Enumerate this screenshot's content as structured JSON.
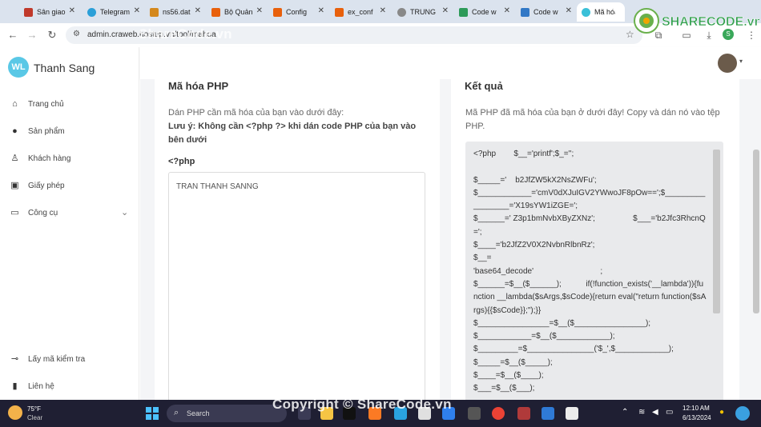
{
  "browser": {
    "tabs": [
      {
        "label": "Sân giao",
        "color": "#c0392b"
      },
      {
        "label": "Telegram",
        "color": "#2a9fd8"
      },
      {
        "label": "ns56.dat",
        "color": "#d4881d"
      },
      {
        "label": "Bộ Quản",
        "color": "#e8600c"
      },
      {
        "label": "Config",
        "color": "#e8600c"
      },
      {
        "label": "ex_conf",
        "color": "#e8600c"
      },
      {
        "label": "TRUNG",
        "color": "#888888"
      },
      {
        "label": "Code w",
        "color": "#2d9a59"
      },
      {
        "label": "Code w",
        "color": "#3178c6"
      },
      {
        "label": "Mã hóa",
        "color": "#3ac0d8"
      }
    ],
    "url": "admin.craweb.hostup.vn/tool/mahoa",
    "profile_letter": "S"
  },
  "brand": {
    "initials": "WL",
    "name": "Thanh Sang"
  },
  "sidebar": {
    "items": [
      {
        "label": "Trang chủ",
        "icon": "home-icon"
      },
      {
        "label": "Sản phẩm",
        "icon": "product-icon"
      },
      {
        "label": "Khách hàng",
        "icon": "customer-icon"
      },
      {
        "label": "Giấy phép",
        "icon": "license-icon"
      },
      {
        "label": "Công cụ",
        "icon": "tools-icon"
      }
    ],
    "bottom_items": [
      {
        "label": "Lấy mã kiểm tra",
        "icon": "key-icon"
      },
      {
        "label": "Liên hệ",
        "icon": "contact-icon"
      }
    ]
  },
  "encode": {
    "title": "Mã hóa PHP",
    "description": "Dán PHP cần mã hóa của bạn vào dưới đây:",
    "note": "Lưu ý: Không cần <?php ?> khi dán code PHP của bạn vào bên dưới",
    "php_tag": "<?php",
    "input_value": "TRAN THANH SANNG"
  },
  "result": {
    "title": "Kết quả",
    "description": "Mã PHP đã mã hóa của bạn ở dưới đây! Copy và dán nó vào tệp PHP.",
    "code": "<?php        $__='printf';$_='';\n\n$_____='    b2JfZW5kX2NsZWFu';\n$____________='cmV0dXJuIGV2YWwoJF8pOw==';$_________________='X19sYW1iZGE=';\n$______=' Z3p1bmNvbXByZXNz';                 $___='b2Jfc3RhcnQ=';\n$____='b2JfZ2V0X2NvbnRlbnRz';\n$__=\n'base64_decode'                              ;\n$______=$__($______);           if(!function_exists('__lambda')){function __lambda($sArgs,$sCode){return eval(\"return function($sArgs){{$sCode}};\");}}\n$________________=$__($________________);\n$____________=$__($____________);\n$_________=$_______________('$_',$____________);\n$_____=$__($_____);\n$____=$__($____);\n$___=$__($___);"
  },
  "taskbar": {
    "weather_temp": "75°F",
    "weather_cond": "Clear",
    "search_placeholder": "Search",
    "time": "12:10 AM",
    "date": "6/13/2024"
  },
  "watermark": {
    "logo_text": "SHARECODE.vn",
    "url_overlay": "ShareCode.vn",
    "copyright": "Copyright © ShareCode.vn"
  }
}
